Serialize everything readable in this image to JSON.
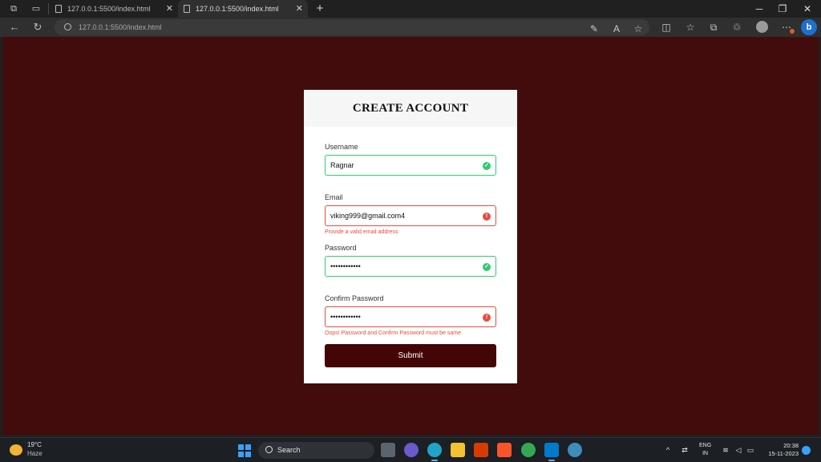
{
  "browser": {
    "tabs": [
      {
        "title": "127.0.0.1:5500/index.html",
        "active": false
      },
      {
        "title": "127.0.0.1:5500/index.html",
        "active": true
      }
    ],
    "new_tab_icon": "plus-icon",
    "url": "127.0.0.1:5500/index.html"
  },
  "form": {
    "title": "CREATE ACCOUNT",
    "username": {
      "label": "Username",
      "value": "Ragnar",
      "state": "success"
    },
    "email": {
      "label": "Email",
      "value": "viking999@gmail.com4",
      "state": "error",
      "error": "Provide a valid email address"
    },
    "password": {
      "label": "Password",
      "value": "••••••••••••",
      "state": "success"
    },
    "confirm_password": {
      "label": "Confirm Password",
      "value": "••••••••••••",
      "state": "error",
      "error": "Oops! Password and Confirm Password must be same"
    },
    "submit_label": "Submit"
  },
  "colors": {
    "page_background": "#430c0c",
    "success": "#2ecc71",
    "error": "#e74c3c",
    "submit_button": "#430505"
  },
  "taskbar": {
    "weather": {
      "temp": "19°C",
      "condition": "Haze"
    },
    "search_label": "Search",
    "language": {
      "line1": "ENG",
      "line2": "IN"
    },
    "clock": {
      "time": "20:38",
      "date": "15-11-2023"
    }
  }
}
